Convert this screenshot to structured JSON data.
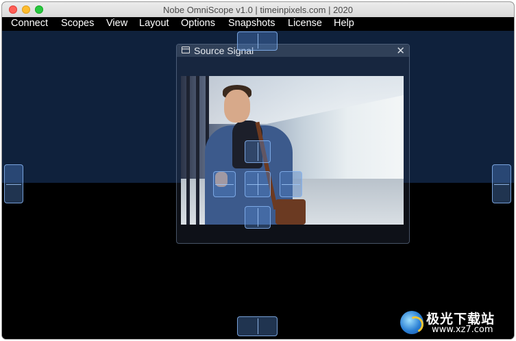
{
  "window": {
    "title": "Nobe OmniScope v1.0 | timeinpixels.com | 2020"
  },
  "menu": [
    "Connect",
    "Scopes",
    "View",
    "Layout",
    "Options",
    "Snapshots",
    "License",
    "Help"
  ],
  "panel": {
    "title": "Source Signal",
    "close": "✕"
  },
  "colors": {
    "upper_bg": "#0f213c",
    "lower_bg": "#000000",
    "handle": "#5082c8"
  },
  "watermark": {
    "name": "极光下载站",
    "url": "www.xz7.com"
  }
}
